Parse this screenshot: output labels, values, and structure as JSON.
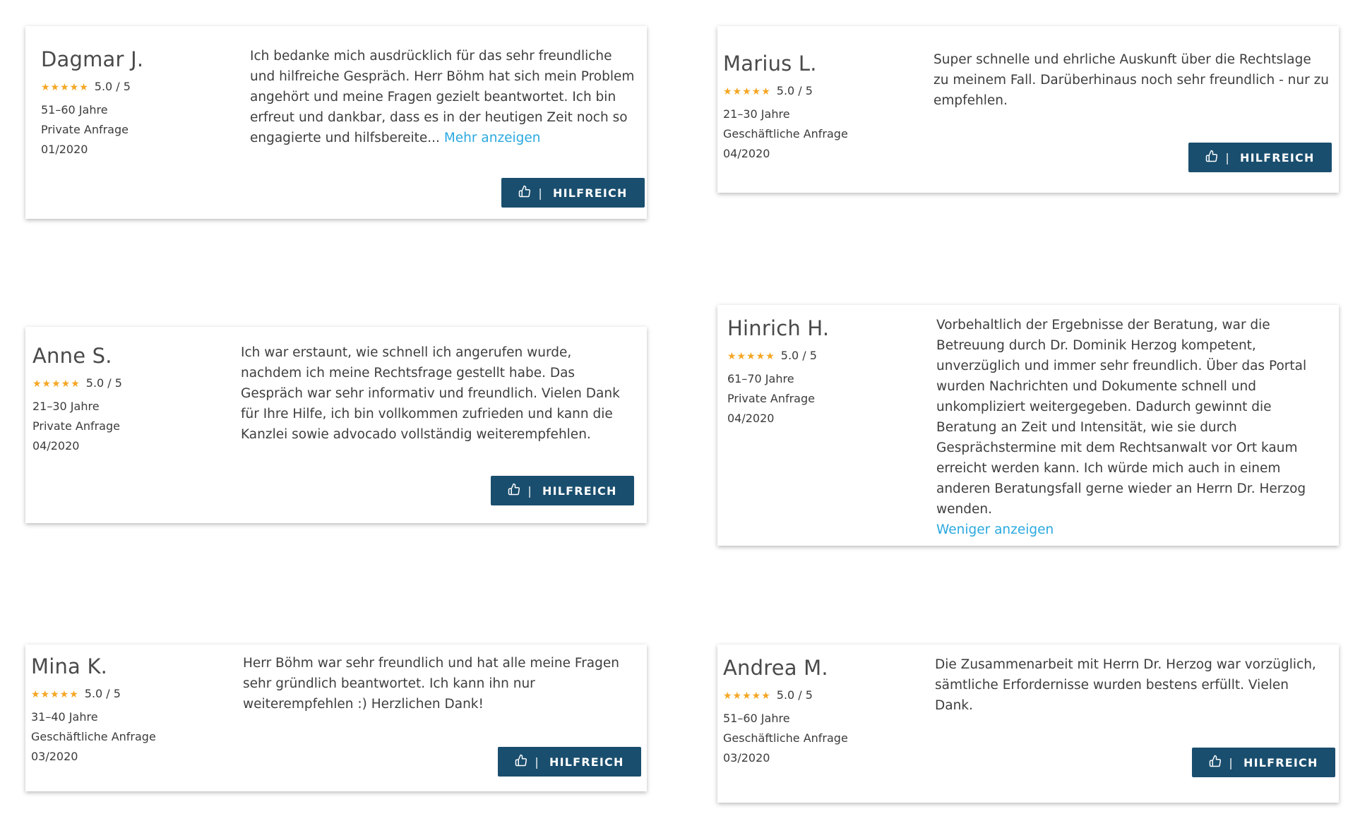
{
  "reviews": [
    {
      "name": "Dagmar J.",
      "rating": "5.0 / 5",
      "age": "51–60 Jahre",
      "type": "Private Anfrage",
      "date": "01/2020",
      "text": "Ich bedanke mich ausdrücklich für das sehr freundliche und hilfreiche Gespräch. Herr Böhm hat sich mein Problem angehört und meine Fragen gezielt beantwortet. Ich bin erfreut und dankbar, dass es in der heutigen Zeit noch so engagierte und hilfsbereite...",
      "link": "Mehr anzeigen",
      "button": "HILFREICH"
    },
    {
      "name": "Marius L.",
      "rating": "5.0 / 5",
      "age": "21–30 Jahre",
      "type": "Geschäftliche Anfrage",
      "date": "04/2020",
      "text": "Super schnelle und ehrliche Auskunft über die Rechtslage zu meinem Fall. Darüberhinaus noch sehr freundlich - nur zu empfehlen.",
      "link": "",
      "button": "HILFREICH"
    },
    {
      "name": "Anne S.",
      "rating": "5.0 / 5",
      "age": "21–30 Jahre",
      "type": "Private Anfrage",
      "date": "04/2020",
      "text": "Ich war erstaunt, wie schnell ich angerufen wurde, nachdem ich meine Rechtsfrage gestellt habe. Das Gespräch war sehr informativ und freundlich. Vielen Dank für Ihre Hilfe, ich bin vollkommen zufrieden und kann die Kanzlei sowie advocado vollständig weiterempfehlen.",
      "link": "",
      "button": "HILFREICH"
    },
    {
      "name": "Hinrich H.",
      "rating": "5.0 / 5",
      "age": "61–70 Jahre",
      "type": "Private Anfrage",
      "date": "04/2020",
      "text": "Vorbehaltlich der Ergebnisse der Beratung, war die Betreuung durch Dr. Dominik Herzog kompetent, unverzüglich und immer sehr freundlich. Über das Portal wurden Nachrichten und Dokumente schnell und unkompliziert weitergegeben. Dadurch gewinnt die Beratung an Zeit und Intensität, wie sie durch Gesprächstermine mit dem Rechtsanwalt vor Ort kaum erreicht werden kann. Ich würde mich auch in einem anderen Beratungsfall gerne wieder an Herrn Dr. Herzog wenden.",
      "link": "Weniger anzeigen",
      "button": ""
    },
    {
      "name": "Mina K.",
      "rating": "5.0 / 5",
      "age": "31–40 Jahre",
      "type": "Geschäftliche Anfrage",
      "date": "03/2020",
      "text": "Herr Böhm war sehr freundlich und hat alle meine Fragen sehr gründlich beantwortet. Ich kann ihn nur weiterempfehlen :) Herzlichen Dank!",
      "link": "",
      "button": "HILFREICH"
    },
    {
      "name": "Andrea M.",
      "rating": "5.0 / 5",
      "age": "51–60 Jahre",
      "type": "Geschäftliche Anfrage",
      "date": "03/2020",
      "text": "Die Zusammenarbeit mit Herrn Dr. Herzog war vorzüglich, sämtliche Erfordernisse wurden bestens erfüllt. Vielen Dank.",
      "link": "",
      "button": "HILFREICH"
    }
  ],
  "colors": {
    "button_bg": "#1a4e6e",
    "star": "#f5a623",
    "link": "#2aa9e0"
  },
  "icons": {
    "stars": "five-star-icon",
    "helpful": "thumbs-up-icon"
  }
}
